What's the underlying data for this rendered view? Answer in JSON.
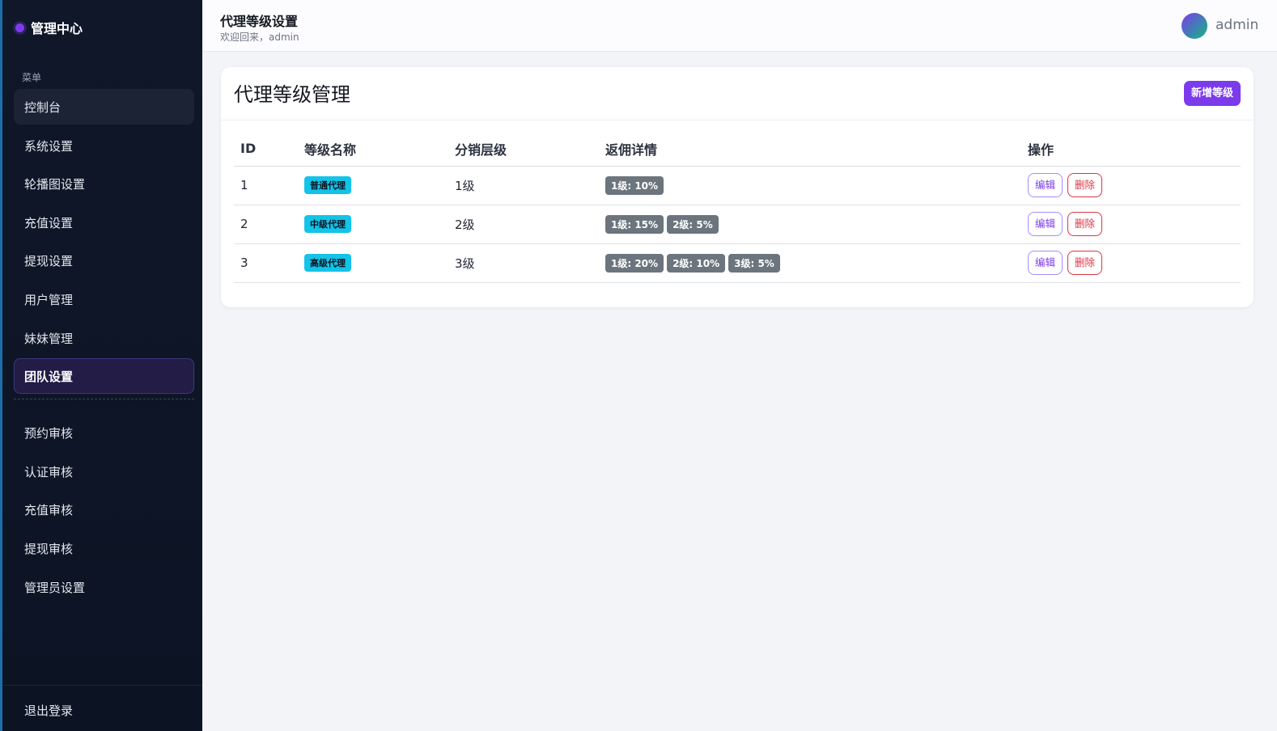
{
  "sidebar": {
    "brand": "管理中心",
    "menu_caption": "菜单",
    "items_top": [
      {
        "label": "控制台"
      },
      {
        "label": "系统设置"
      },
      {
        "label": "轮播图设置"
      },
      {
        "label": "充值设置"
      },
      {
        "label": "提现设置"
      },
      {
        "label": "用户管理"
      },
      {
        "label": "妹妹管理"
      },
      {
        "label": "团队设置"
      }
    ],
    "items_bottom": [
      {
        "label": "预约审核"
      },
      {
        "label": "认证审核"
      },
      {
        "label": "充值审核"
      },
      {
        "label": "提现审核"
      },
      {
        "label": "管理员设置"
      }
    ],
    "logout": "退出登录"
  },
  "header": {
    "title": "代理等级设置",
    "welcome": "欢迎回来，admin",
    "username": "admin"
  },
  "card": {
    "title": "代理等级管理",
    "add_button": "新增等级"
  },
  "table": {
    "columns": [
      "ID",
      "等级名称",
      "分销层级",
      "返佣详情",
      "操作"
    ],
    "rows": [
      {
        "id": "1",
        "name": "普通代理",
        "levels": "1级",
        "commissions": [
          "1级: 10%"
        ],
        "edit": "编辑",
        "delete": "删除"
      },
      {
        "id": "2",
        "name": "中级代理",
        "levels": "2级",
        "commissions": [
          "1级: 15%",
          "2级: 5%"
        ],
        "edit": "编辑",
        "delete": "删除"
      },
      {
        "id": "3",
        "name": "高级代理",
        "levels": "3级",
        "commissions": [
          "1级: 20%",
          "2级: 10%",
          "3级: 5%"
        ],
        "edit": "编辑",
        "delete": "删除"
      }
    ]
  },
  "colors": {
    "accent": "#7c3aed",
    "sidebar_bg": "#0f1729",
    "name_badge": "#13c3e8",
    "commission_badge": "#6c757d",
    "danger": "#dc3545"
  }
}
